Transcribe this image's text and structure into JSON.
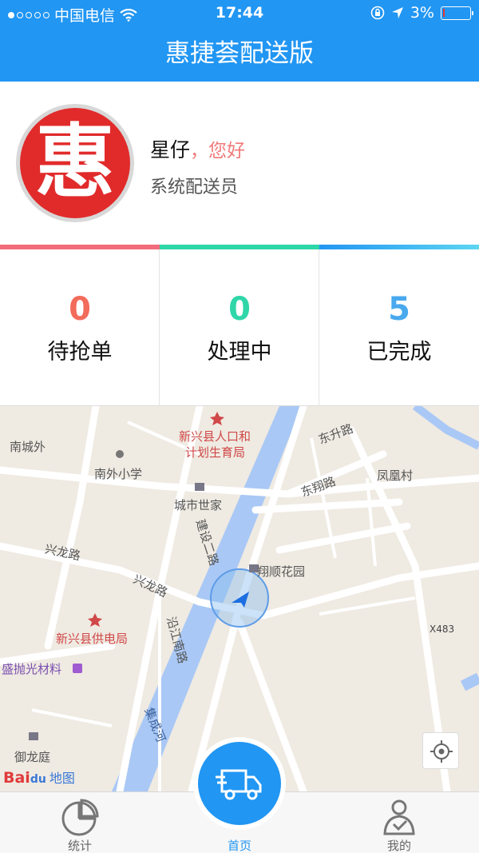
{
  "status_bar": {
    "carrier": "中国电信",
    "time": "17:44",
    "battery": "3%"
  },
  "nav": {
    "title": "惠捷荟配送版"
  },
  "profile": {
    "logo_char": "惠",
    "name": "星仔",
    "greeting": "，您好",
    "role": "系统配送员"
  },
  "stats": [
    {
      "count": "0",
      "label": "待抢单",
      "color": "#f26b5b"
    },
    {
      "count": "0",
      "label": "处理中",
      "color": "#2fd6a8"
    },
    {
      "count": "5",
      "label": "已完成",
      "color": "#49a9ee"
    }
  ],
  "map": {
    "labels": {
      "nanchengwai": "南城外",
      "nanwai_school": "南外小学",
      "population_office_1": "新兴县人口和",
      "population_office_2": "计划生育局",
      "chengshi_shijia": "城市世家",
      "dongsheng_road": "东升路",
      "dongxiang_road": "东翔路",
      "fenghuang_village": "凤凰村",
      "jianshe_road": "建设二路",
      "xinglong_road_1": "兴龙路",
      "xinglong_road_2": "兴龙路",
      "xiangshun_garden": "翔顺花园",
      "power_bureau": "新兴县供电局",
      "yanjiang_road": "沿江南路",
      "shengpao": "盛抛光材料",
      "x483": "X483",
      "jicheng_river": "集成河",
      "yulongting": "御龙庭"
    },
    "watermark": "Bai",
    "watermark_du": "du",
    "watermark_map": "地图"
  },
  "tabs": [
    {
      "label": "统计"
    },
    {
      "label": "首页"
    },
    {
      "label": "我的"
    }
  ]
}
